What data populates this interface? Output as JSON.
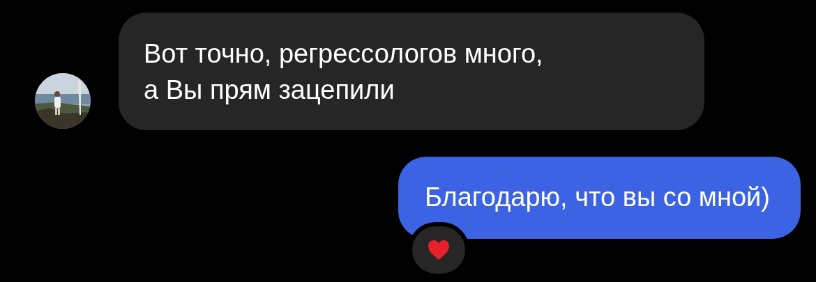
{
  "messages": [
    {
      "kind": "incoming",
      "text": "Вот точно, регрессологов много,\nа Вы прям зацепили"
    },
    {
      "kind": "outgoing",
      "text": "Благодарю, что вы со мной)",
      "reaction": {
        "kind": "heart"
      }
    }
  ]
}
